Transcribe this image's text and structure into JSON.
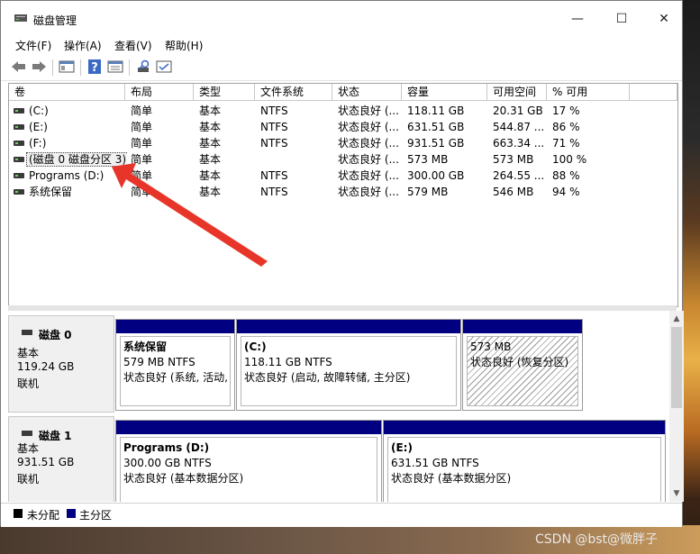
{
  "window": {
    "title": "磁盘管理",
    "controls": {
      "minimize": "—",
      "maximize": "☐",
      "close": "✕"
    }
  },
  "menu": [
    "文件(F)",
    "操作(A)",
    "查看(V)",
    "帮助(H)"
  ],
  "toolbar": [
    "back-icon",
    "forward-icon",
    "console-tree-icon",
    "help-icon",
    "properties-icon",
    "refresh-icon",
    "connect-icon"
  ],
  "volumes": {
    "columns": [
      "卷",
      "布局",
      "类型",
      "文件系统",
      "状态",
      "容量",
      "可用空间",
      "% 可用"
    ],
    "rows": [
      [
        "(C:)",
        "简单",
        "基本",
        "NTFS",
        "状态良好 (...",
        "118.11 GB",
        "20.31 GB",
        "17 %"
      ],
      [
        "(E:)",
        "简单",
        "基本",
        "NTFS",
        "状态良好 (...",
        "631.51 GB",
        "544.87 ...",
        "86 %"
      ],
      [
        "(F:)",
        "简单",
        "基本",
        "NTFS",
        "状态良好 (...",
        "931.51 GB",
        "663.34 ...",
        "71 %"
      ],
      [
        "(磁盘 0 磁盘分区 3)",
        "简单",
        "基本",
        "",
        "状态良好 (...",
        "573 MB",
        "573 MB",
        "100 %"
      ],
      [
        "Programs (D:)",
        "简单",
        "基本",
        "NTFS",
        "状态良好 (...",
        "300.00 GB",
        "264.55 ...",
        "88 %"
      ],
      [
        "系统保留",
        "简单",
        "基本",
        "NTFS",
        "状态良好 (...",
        "579 MB",
        "546 MB",
        "94 %"
      ]
    ]
  },
  "disks": [
    {
      "name": "磁盘 0",
      "type": "基本",
      "size": "119.24 GB",
      "status": "联机",
      "partitions": [
        {
          "title": "系统保留",
          "size": "579 MB NTFS",
          "status": "状态良好 (系统, 活动, 主分区)"
        },
        {
          "title": "(C:)",
          "size": "118.11 GB NTFS",
          "status": "状态良好 (启动, 故障转储, 主分区)"
        },
        {
          "title": "",
          "size": "573 MB",
          "status": "状态良好 (恢复分区)"
        }
      ]
    },
    {
      "name": "磁盘 1",
      "type": "基本",
      "size": "931.51 GB",
      "status": "联机",
      "partitions": [
        {
          "title": "Programs  (D:)",
          "size": "300.00 GB NTFS",
          "status": "状态良好 (基本数据分区)"
        },
        {
          "title": "(E:)",
          "size": "631.51 GB NTFS",
          "status": "状态良好 (基本数据分区)"
        }
      ]
    }
  ],
  "legend": [
    "未分配",
    "主分区"
  ],
  "colors": {
    "primary_partition": "#000080",
    "unallocated": "#000000",
    "annotation_arrow": "#e8352a"
  },
  "watermark": "CSDN @bst@微胖子"
}
